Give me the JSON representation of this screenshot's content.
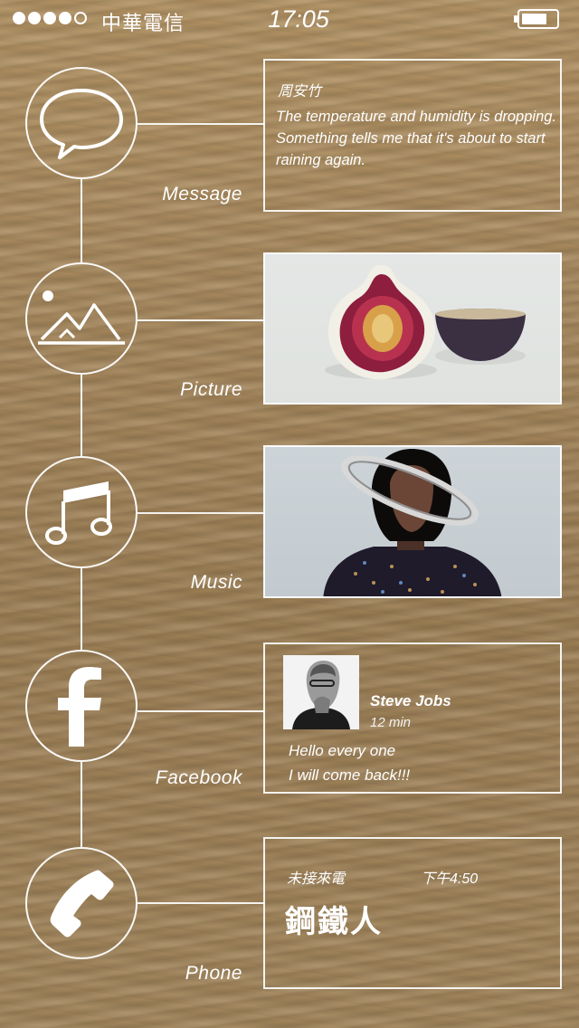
{
  "status_bar": {
    "signal_bars_filled": 4,
    "signal_bars_total": 5,
    "carrier": "中華電信",
    "time": "17:05",
    "battery_level": 0.75
  },
  "timeline": {
    "message": {
      "label": "Message",
      "icon": "speech-bubble-icon",
      "sender": "周安竹",
      "text": "The temperature and humidity is dropping. Something tells me that it's about to start raining again."
    },
    "picture": {
      "label": "Picture",
      "icon": "mountain-picture-icon",
      "image": "fig-photo"
    },
    "music": {
      "label": "Music",
      "icon": "music-note-icon",
      "image": "album-cover"
    },
    "facebook": {
      "label": "Facebook",
      "icon": "facebook-icon",
      "author": "Steve Jobs",
      "time_ago": "12 min",
      "lines": [
        "Hello every one",
        "I will come back!!!"
      ]
    },
    "phone": {
      "label": "Phone",
      "icon": "phone-handset-icon",
      "status": "未接來電",
      "time": "下午4:50",
      "caller": "鋼鐵人"
    }
  },
  "colors": {
    "background": "#a6885d",
    "line": "#ffffff"
  }
}
